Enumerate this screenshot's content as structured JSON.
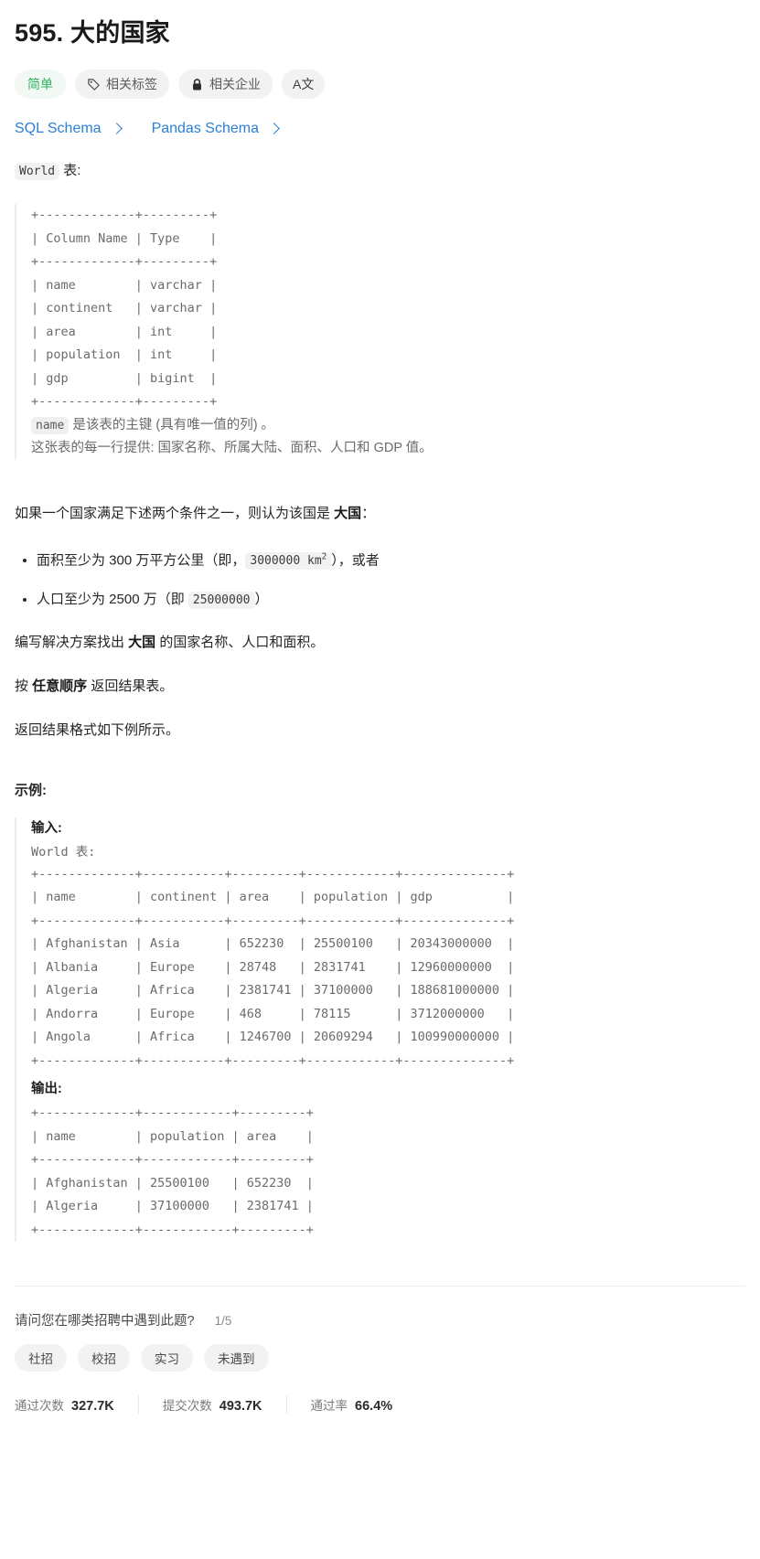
{
  "problem": {
    "title": "595. 大的国家",
    "difficulty": "简单",
    "tags_label": "相关标签",
    "companies_label": "相关企业",
    "translate_label": "A文"
  },
  "schema_links": [
    {
      "label": "SQL Schema"
    },
    {
      "label": "Pandas Schema"
    }
  ],
  "table_intro": {
    "code": "World",
    "suffix": " 表:"
  },
  "schema_table": "+-------------+---------+\n| Column Name | Type    |\n+-------------+---------+\n| name        | varchar |\n| continent   | varchar |\n| area        | int     |\n| population  | int     |\n| gdp         | bigint  |\n+-------------+---------+",
  "schema_notes": {
    "pk_code": "name",
    "pk_text": " 是该表的主键 (具有唯一值的列) 。",
    "row_text": "这张表的每一行提供: 国家名称、所属大陆、面积、人口和 GDP 值。"
  },
  "description": {
    "intro_before": "如果一个国家满足下述两个条件之一，则认为该国是 ",
    "intro_bold": "大国",
    "intro_after": "：",
    "conditions": [
      {
        "before": "面积至少为 300 万平方公里（即，",
        "code": "3000000 km",
        "sup": "2",
        "after": "），或者"
      },
      {
        "before": "人口至少为 2500 万（即 ",
        "code": "25000000",
        "sup": "",
        "after": "）"
      }
    ],
    "task_before": "编写解决方案找出 ",
    "task_bold": "大国",
    "task_after": " 的国家名称、人口和面积。",
    "order_before": "按 ",
    "order_bold": "任意顺序",
    "order_after": " 返回结果表。",
    "format_note": "返回结果格式如下例所示。"
  },
  "example": {
    "heading": "示例:",
    "input_label": "输入:",
    "input_sub": "World 表:",
    "input_table": "+-------------+-----------+---------+------------+--------------+\n| name        | continent | area    | population | gdp          |\n+-------------+-----------+---------+------------+--------------+\n| Afghanistan | Asia      | 652230  | 25500100   | 20343000000  |\n| Albania     | Europe    | 28748   | 2831741    | 12960000000  |\n| Algeria     | Africa    | 2381741 | 37100000   | 188681000000 |\n| Andorra     | Europe    | 468     | 78115      | 3712000000   |\n| Angola      | Africa    | 1246700 | 20609294   | 100990000000 |\n+-------------+-----------+---------+------------+--------------+",
    "output_label": "输出:",
    "output_table": "+-------------+------------+---------+\n| name        | population | area    |\n+-------------+------------+---------+\n| Afghanistan | 25500100   | 652230  |\n| Algeria     | 37100000   | 2381741 |\n+-------------+------------+---------+"
  },
  "example_data": {
    "input_columns": [
      "name",
      "continent",
      "area",
      "population",
      "gdp"
    ],
    "input_rows": [
      [
        "Afghanistan",
        "Asia",
        "652230",
        "25500100",
        "20343000000"
      ],
      [
        "Albania",
        "Europe",
        "28748",
        "2831741",
        "12960000000"
      ],
      [
        "Algeria",
        "Africa",
        "2381741",
        "37100000",
        "188681000000"
      ],
      [
        "Andorra",
        "Europe",
        "468",
        "78115",
        "3712000000"
      ],
      [
        "Angola",
        "Africa",
        "1246700",
        "20609294",
        "100990000000"
      ]
    ],
    "output_columns": [
      "name",
      "population",
      "area"
    ],
    "output_rows": [
      [
        "Afghanistan",
        "25500100",
        "652230"
      ],
      [
        "Algeria",
        "37100000",
        "2381741"
      ]
    ],
    "schema_columns": [
      "name",
      "continent",
      "area",
      "population",
      "gdp"
    ],
    "schema_types": [
      "varchar",
      "varchar",
      "int",
      "int",
      "bigint"
    ]
  },
  "survey": {
    "question": "请问您在哪类招聘中遇到此题?",
    "progress": "1/5",
    "options": [
      "社招",
      "校招",
      "实习",
      "未遇到"
    ]
  },
  "stats": [
    {
      "label": "通过次数",
      "value": "327.7K"
    },
    {
      "label": "提交次数",
      "value": "493.7K"
    },
    {
      "label": "通过率",
      "value": "66.4%"
    }
  ],
  "colors": {
    "accent_link": "#2b7fd4",
    "easy_green": "#2db55d",
    "chip_bg": "#f2f2f2",
    "code_gray": "#6b6b6b"
  }
}
